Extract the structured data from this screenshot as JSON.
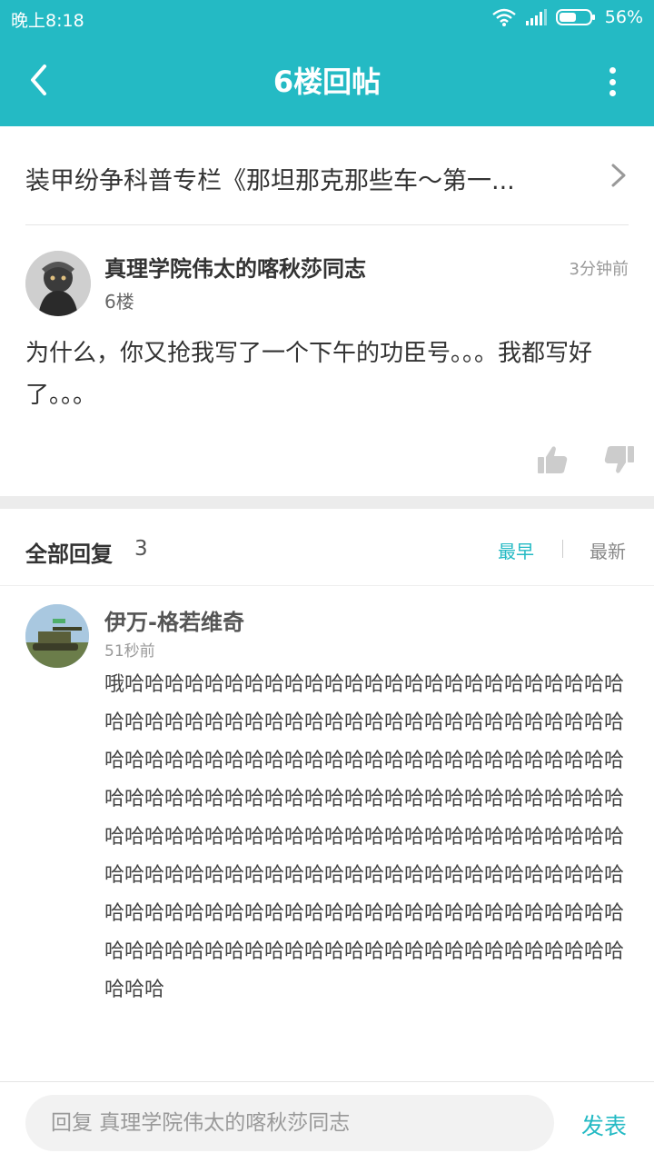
{
  "status_bar": {
    "time": "晚上8:18",
    "battery_percent": "56%",
    "battery_level": 0.56
  },
  "header": {
    "title": "6楼回帖",
    "background_color": "#24bac4"
  },
  "thread": {
    "title": "装甲纷争科普专栏《那坦那克那些车～第一..."
  },
  "post": {
    "author": "真理学院伟太的喀秋莎同志",
    "time": "3分钟前",
    "floor": "6楼",
    "content": "为什么，你又抢我写了一个下午的功臣号。。。我都写好了。。。"
  },
  "replies": {
    "title": "全部回复",
    "count": "3",
    "sort_earliest": "最早",
    "sort_latest": "最新",
    "sort_active": "最早",
    "items": [
      {
        "author": "伊万-格若维奇",
        "time": "51秒前",
        "content": "哦哈哈哈哈哈哈哈哈哈哈哈哈哈哈哈哈哈哈哈哈哈哈哈哈哈哈哈哈哈哈哈哈哈哈哈哈哈哈哈哈哈哈哈哈哈哈哈哈哈哈哈哈哈哈哈哈哈哈哈哈哈哈哈哈哈哈哈哈哈哈哈哈哈哈哈哈哈哈哈哈哈哈哈哈哈哈哈哈哈哈哈哈哈哈哈哈哈哈哈哈哈哈哈哈哈哈哈哈哈哈哈哈哈哈哈哈哈哈哈哈哈哈哈哈哈哈哈哈哈哈哈哈哈哈哈哈哈哈哈哈哈哈哈哈哈哈哈哈哈哈哈哈哈哈哈哈哈哈哈哈哈哈哈哈哈哈哈哈哈哈哈哈哈哈哈哈哈哈哈哈哈哈哈哈哈哈哈哈哈哈哈哈哈哈哈哈哈哈哈哈哈哈哈哈哈哈哈哈哈哈"
      }
    ]
  },
  "footer": {
    "input_placeholder": "回复 真理学院伟太的喀秋莎同志",
    "submit_label": "发表"
  },
  "icons": {
    "back": "back-arrow-icon",
    "more": "more-vertical-icon",
    "chevron": "chevron-right-icon",
    "like": "thumbs-up-icon",
    "dislike": "thumbs-down-icon",
    "wifi": "wifi-icon",
    "signal": "signal-icon",
    "battery": "battery-icon"
  },
  "colors": {
    "accent": "#24bac4",
    "muted": "#999999",
    "icon_gray": "#cccccc"
  }
}
